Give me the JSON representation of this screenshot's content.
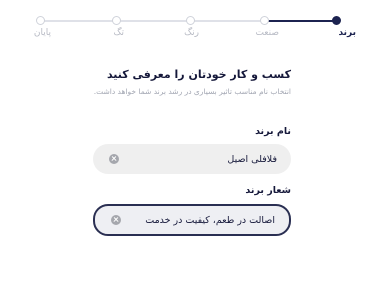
{
  "stepper": {
    "steps": [
      {
        "label": "برند",
        "state": "active"
      },
      {
        "label": "صنعت",
        "state": "pending"
      },
      {
        "label": "رنگ",
        "state": "pending"
      },
      {
        "label": "تگ",
        "state": "pending"
      },
      {
        "label": "پایان",
        "state": "pending"
      }
    ],
    "current_step": 1
  },
  "main": {
    "title": "کسب و کار خودتان را معرفی کنید",
    "subtitle": "انتخاب نام مناسب تاثیر بسیاری در رشد برند شما خواهد داشت."
  },
  "brand_name": {
    "label": "نام برند",
    "value": "فلافلی اصیل"
  },
  "slogan": {
    "label": "شعار برند",
    "value": "اصالت در طعم، کیفیت در خدمت"
  },
  "colors": {
    "accent": "#1c2350",
    "inactive": "#cfd2da"
  }
}
